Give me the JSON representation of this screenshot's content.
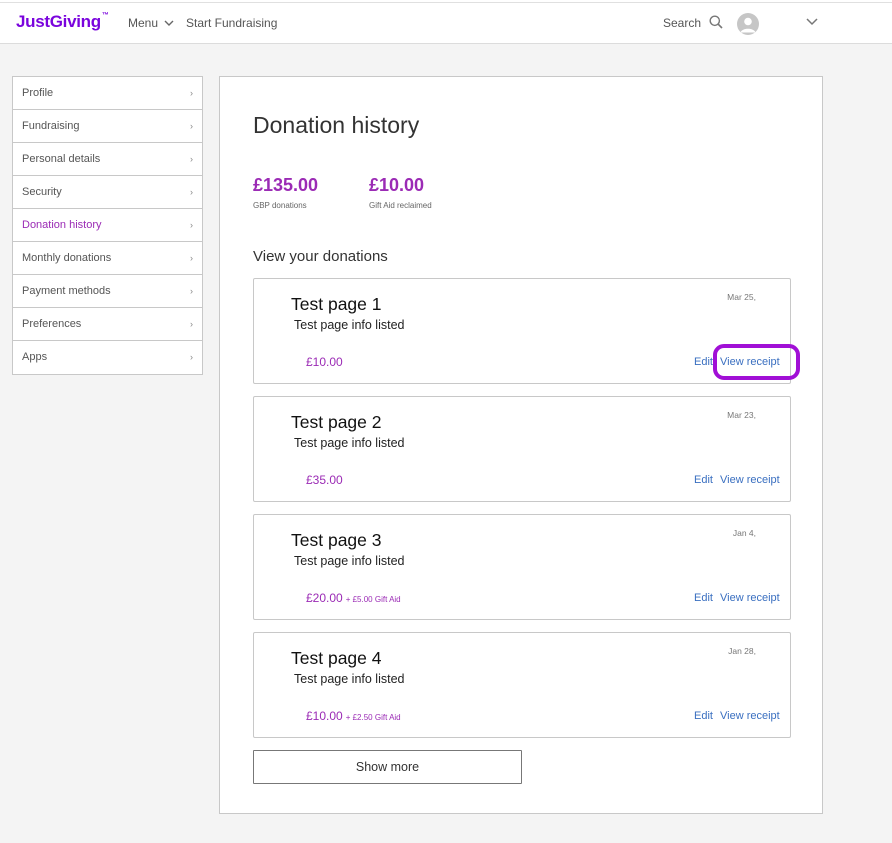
{
  "header": {
    "logo": "JustGiving",
    "logo_tm": "™",
    "menu_label": "Menu",
    "start_label": "Start Fundraising",
    "search_label": "Search"
  },
  "sidebar": {
    "items": [
      {
        "label": "Profile",
        "active": false
      },
      {
        "label": "Fundraising",
        "active": false
      },
      {
        "label": "Personal details",
        "active": false
      },
      {
        "label": "Security",
        "active": false
      },
      {
        "label": "Donation history",
        "active": true
      },
      {
        "label": "Monthly donations",
        "active": false
      },
      {
        "label": "Payment methods",
        "active": false
      },
      {
        "label": "Preferences",
        "active": false
      },
      {
        "label": "Apps",
        "active": false
      }
    ],
    "chevron": "›"
  },
  "main": {
    "title": "Donation history",
    "stats": [
      {
        "value": "£135.00",
        "label": "GBP donations"
      },
      {
        "value": "£10.00",
        "label": "Gift Aid reclaimed"
      }
    ],
    "section_title": "View your donations",
    "donations": [
      {
        "title": "Test page 1",
        "info": "Test page info listed",
        "date": "Mar 25,",
        "amount": "£10.00",
        "gift_aid": "",
        "edit": "Edit",
        "receipt": "View receipt"
      },
      {
        "title": "Test page 2",
        "info": "Test page info listed",
        "date": "Mar 23,",
        "amount": "£35.00",
        "gift_aid": "",
        "edit": "Edit",
        "receipt": "View receipt"
      },
      {
        "title": "Test page 3",
        "info": "Test page info listed",
        "date": "Jan 4,",
        "amount": "£20.00",
        "gift_aid": "+ £5.00 Gift Aid",
        "edit": "Edit",
        "receipt": "View receipt"
      },
      {
        "title": "Test page 4",
        "info": "Test page info listed",
        "date": "Jan 28,",
        "amount": "£10.00",
        "gift_aid": "+ £2.50 Gift Aid",
        "edit": "Edit",
        "receipt": "View receipt"
      }
    ],
    "show_more": "Show more"
  },
  "colors": {
    "brand": "#7a04dd",
    "accent": "#9b2bb5",
    "link": "#3a6fc0",
    "highlight": "#a10fd6"
  },
  "icons": {
    "menu": "chevron-down-icon",
    "search": "search-icon",
    "avatar": "user-avatar-icon",
    "account": "chevron-down-icon"
  }
}
